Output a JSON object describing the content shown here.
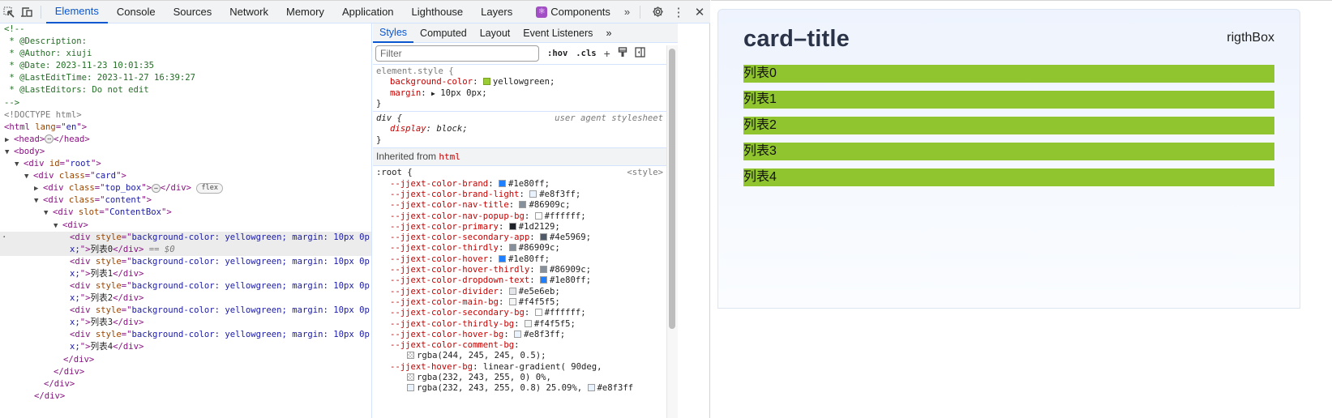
{
  "devtools": {
    "main_tabs": [
      {
        "label": "Elements",
        "active": true
      },
      {
        "label": "Console"
      },
      {
        "label": "Sources"
      },
      {
        "label": "Network"
      },
      {
        "label": "Memory"
      },
      {
        "label": "Application"
      },
      {
        "label": "Lighthouse"
      },
      {
        "label": "Layers"
      },
      {
        "label": "Components"
      }
    ],
    "more_tabs": "»",
    "icons": {
      "inspect": "inspect-element-icon",
      "device": "device-toolbar-icon",
      "settings": "gear-icon",
      "menu": "kebab-menu-icon",
      "close": "close-icon"
    }
  },
  "elements_tree": {
    "comment": [
      "<!--",
      " * @Description:",
      " * @Author: xiuji",
      " * @Date: 2023-11-23 10:01:35",
      " * @LastEditTime: 2023-11-27 16:39:27",
      " * @LastEditors: Do not edit",
      "-->"
    ],
    "doctype": "<!DOCTYPE html>",
    "html_open": {
      "tag": "html",
      "attr": "lang",
      "value": "en"
    },
    "head": "head",
    "body": "body",
    "root_div": {
      "attr": "id",
      "value": "root"
    },
    "card_div": {
      "attr": "class",
      "value": "card"
    },
    "topbox_div": {
      "attr": "class",
      "value": "top_box",
      "badge": "flex"
    },
    "content_div": {
      "attr": "class",
      "value": "content"
    },
    "slot_div": {
      "attr": "slot",
      "value": "ContentBox"
    },
    "style_attr": "style",
    "style_value_line1": "background-color: yellowgreen; margin: 10px 0p",
    "style_value_line2": "x;",
    "items": [
      "列表0",
      "列表1",
      "列表2",
      "列表3",
      "列表4"
    ],
    "selected_marker": "== $0"
  },
  "styles_pane": {
    "tabs": [
      {
        "label": "Styles",
        "active": true
      },
      {
        "label": "Computed"
      },
      {
        "label": "Layout"
      },
      {
        "label": "Event Listeners"
      }
    ],
    "more_tabs": "»",
    "filter_placeholder": "Filter",
    "hov": ":hov",
    "cls": ".cls",
    "element_style": {
      "selector": "element.style {",
      "props": [
        {
          "name": "background-color",
          "value": "yellowgreen",
          "swatch": "#9acd32"
        },
        {
          "name": "margin",
          "value": "10px 0px"
        }
      ]
    },
    "ua_rule": {
      "selector": "div {",
      "origin": "user agent stylesheet",
      "prop": "display",
      "value": "block"
    },
    "inherited_label": "Inherited from",
    "inherited_tag": "html",
    "root_rule": {
      "selector": ":root {",
      "origin": "<style>",
      "props": [
        {
          "name": "--jjext-color-brand",
          "value": "#1e80ff",
          "swatch": "#1e80ff"
        },
        {
          "name": "--jjext-color-brand-light",
          "value": "#e8f3ff",
          "swatch": "#e8f3ff"
        },
        {
          "name": "--jjext-color-nav-title",
          "value": "#86909c",
          "swatch": "#86909c"
        },
        {
          "name": "--jjext-color-nav-popup-bg",
          "value": "#ffffff",
          "swatch": "#ffffff"
        },
        {
          "name": "--jjext-color-primary",
          "value": "#1d2129",
          "swatch": "#1d2129"
        },
        {
          "name": "--jjext-color-secondary-app",
          "value": "#4e5969",
          "swatch": "#4e5969"
        },
        {
          "name": "--jjext-color-thirdly",
          "value": "#86909c",
          "swatch": "#86909c"
        },
        {
          "name": "--jjext-color-hover",
          "value": "#1e80ff",
          "swatch": "#1e80ff"
        },
        {
          "name": "--jjext-color-hover-thirdly",
          "value": "#86909c",
          "swatch": "#86909c"
        },
        {
          "name": "--jjext-color-dropdown-text",
          "value": "#1e80ff",
          "swatch": "#1e80ff"
        },
        {
          "name": "--jjext-color-divider",
          "value": "#e5e6eb",
          "swatch": "#e5e6eb"
        },
        {
          "name": "--jjext-color-main-bg",
          "value": "#f4f5f5",
          "swatch": "#f4f5f5"
        },
        {
          "name": "--jjext-color-secondary-bg",
          "value": "#ffffff",
          "swatch": "#ffffff"
        },
        {
          "name": "--jjext-color-thirdly-bg",
          "value": "#f4f5f5",
          "swatch": "#f4f5f5"
        },
        {
          "name": "--jjext-color-hover-bg",
          "value": "#e8f3ff",
          "swatch": "#e8f3ff"
        }
      ],
      "comment_bg": {
        "name": "--jjext-color-comment-bg",
        "value": "rgba(244, 245, 245, 0.5);"
      },
      "hover_bg": {
        "name": "--jjext-hover-bg",
        "value": "linear-gradient( 90deg,",
        "stop1": "rgba(232, 243, 255, 0) 0%,",
        "stop2": "rgba(232, 243, 255, 0.8) 25.09%,",
        "stop3": "#e8f3ff"
      }
    }
  },
  "page": {
    "card_title": "card–title",
    "right_box": "rigthBox",
    "list_items": [
      "列表0",
      "列表1",
      "列表2",
      "列表3",
      "列表4"
    ],
    "list_color": "#9acd32"
  }
}
